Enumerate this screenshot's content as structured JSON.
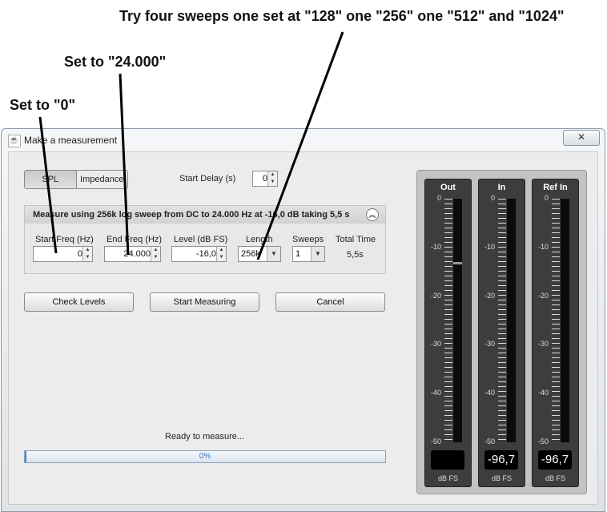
{
  "annotations": {
    "top": "Try four sweeps one set at \"128\" one \"256\" one \"512\" and \"1024\"",
    "mid": "Set to \"24.000\"",
    "left": "Set to \"0\""
  },
  "window": {
    "title": "Make a measurement",
    "close": "✕"
  },
  "tabs": {
    "spl": "SPL",
    "impedance": "Impedance"
  },
  "start_delay": {
    "label": "Start Delay (s)",
    "value": "0"
  },
  "panel": {
    "title": "Measure using  256k log sweep from DC to 24.000 Hz at -16,0 dB taking 5,5 s",
    "collapse": "︽"
  },
  "fields": {
    "start_freq": {
      "label": "Start Freq (Hz)",
      "value": "0"
    },
    "end_freq": {
      "label": "End Freq (Hz)",
      "value": "24.000"
    },
    "level": {
      "label": "Level (dB FS)",
      "value": "-16,0"
    },
    "length": {
      "label": "Length",
      "value": "256k"
    },
    "sweeps": {
      "label": "Sweeps",
      "value": "1"
    },
    "total_time": {
      "label": "Total Time",
      "value": "5,5s"
    }
  },
  "buttons": {
    "check_levels": "Check Levels",
    "start_measuring": "Start Measuring",
    "cancel": "Cancel"
  },
  "status": "Ready to measure...",
  "progress": {
    "value": 0,
    "text": "0%",
    "color": "#3f8fd8"
  },
  "meters": {
    "out": {
      "title": "Out",
      "readout": "",
      "unit": "dB FS",
      "level_db": -13
    },
    "in": {
      "title": "In",
      "readout": "-96,7",
      "unit": "dB FS"
    },
    "refin": {
      "title": "Ref In",
      "readout": "-96,7",
      "unit": "dB FS"
    },
    "scale": [
      "0",
      "-10",
      "-20",
      "-30",
      "-40",
      "-50"
    ]
  }
}
